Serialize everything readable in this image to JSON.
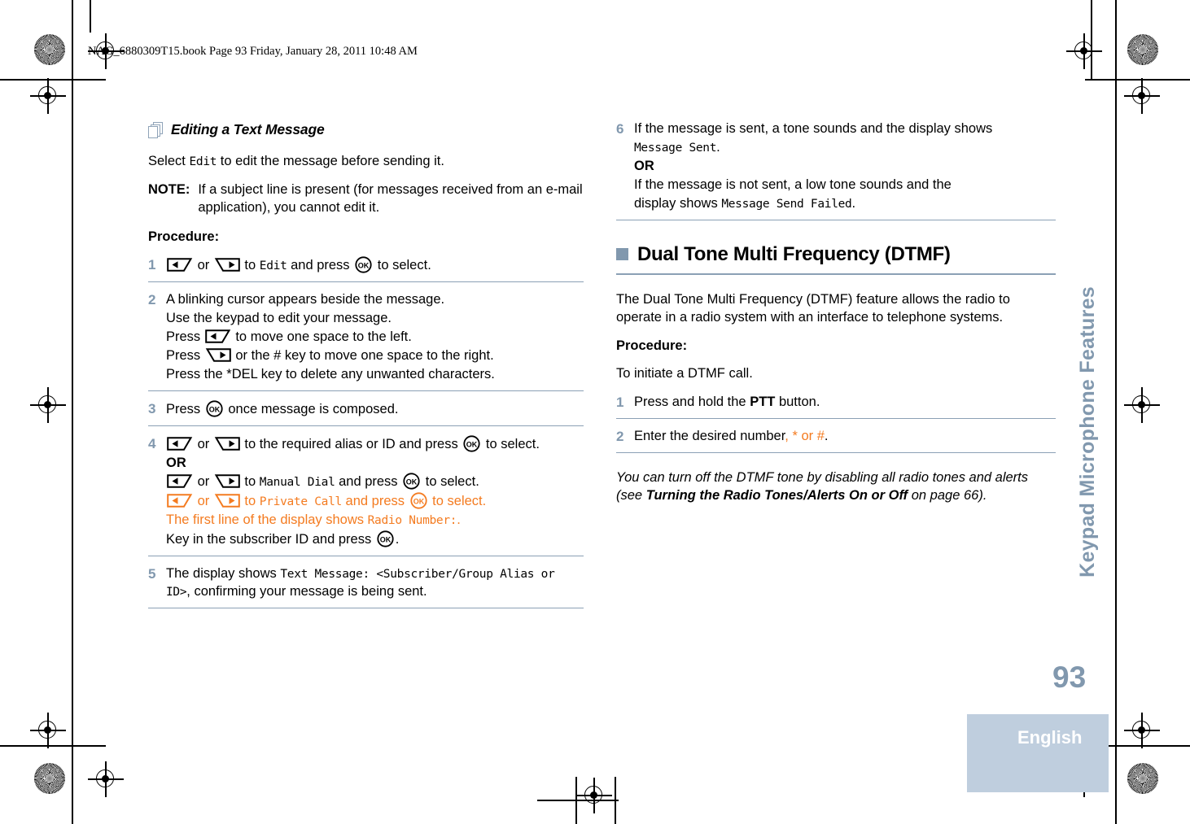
{
  "page": {
    "slug": "NAG_6880309T15.book  Page 93  Friday, January 28, 2011  10:48 AM",
    "number": "93",
    "language": "English",
    "side_tab": "Keypad Microphone Features",
    "accent_blue": "#8198ae",
    "accent_orange": "#F47B20",
    "band_blue": "#bfcede"
  },
  "left_column": {
    "subheading": "Editing a Text Message",
    "intro_prefix": "Select ",
    "intro_mono": "Edit",
    "intro_suffix": " to edit the message before sending it.",
    "note_label": "NOTE:",
    "note_body": "If a subject line is present (for messages received from an e-mail application), you cannot edit it.",
    "procedure_label": "Procedure:",
    "steps": [
      {
        "num": "1",
        "lines": [
          {
            "parts": [
              {
                "type": "key-left"
              },
              {
                "type": "text",
                "text": " or "
              },
              {
                "type": "key-right"
              },
              {
                "type": "text",
                "text": " to "
              },
              {
                "type": "mono",
                "text": "Edit"
              },
              {
                "type": "text",
                "text": " and press "
              },
              {
                "type": "key-ok"
              },
              {
                "type": "text",
                "text": " to select."
              }
            ]
          }
        ]
      },
      {
        "num": "2",
        "lines": [
          {
            "parts": [
              {
                "type": "text",
                "text": "A blinking cursor appears beside the message."
              }
            ]
          },
          {
            "parts": [
              {
                "type": "text",
                "text": "Use the keypad to edit your message."
              }
            ]
          },
          {
            "parts": [
              {
                "type": "text",
                "text": "Press "
              },
              {
                "type": "key-left"
              },
              {
                "type": "text",
                "text": " to move one space to the left."
              }
            ]
          },
          {
            "parts": [
              {
                "type": "text",
                "text": "Press "
              },
              {
                "type": "key-right"
              },
              {
                "type": "text",
                "text": " or the # key to move one space to the right."
              }
            ]
          },
          {
            "parts": [
              {
                "type": "text",
                "text": "Press the *DEL key to delete any unwanted characters."
              }
            ]
          }
        ]
      },
      {
        "num": "3",
        "lines": [
          {
            "parts": [
              {
                "type": "text",
                "text": "Press "
              },
              {
                "type": "key-ok"
              },
              {
                "type": "text",
                "text": " once message is composed."
              }
            ]
          }
        ]
      },
      {
        "num": "4",
        "lines": [
          {
            "parts": [
              {
                "type": "key-left"
              },
              {
                "type": "text",
                "text": " or "
              },
              {
                "type": "key-right"
              },
              {
                "type": "text",
                "text": " to the required alias or ID and press "
              },
              {
                "type": "key-ok"
              },
              {
                "type": "text",
                "text": " to select."
              }
            ]
          },
          {
            "parts": [
              {
                "type": "bold",
                "text": "OR"
              }
            ]
          },
          {
            "parts": [
              {
                "type": "key-left"
              },
              {
                "type": "text",
                "text": " or "
              },
              {
                "type": "key-right"
              },
              {
                "type": "text",
                "text": " to "
              },
              {
                "type": "mono",
                "text": "Manual Dial"
              },
              {
                "type": "text",
                "text": " and press "
              },
              {
                "type": "key-ok"
              },
              {
                "type": "text",
                "text": " to select."
              }
            ]
          },
          {
            "orange": true,
            "parts": [
              {
                "type": "key-left"
              },
              {
                "type": "text",
                "text": " or "
              },
              {
                "type": "key-right"
              },
              {
                "type": "text",
                "text": " to "
              },
              {
                "type": "mono",
                "text": "Private Call"
              },
              {
                "type": "text",
                "text": " and press "
              },
              {
                "type": "key-ok"
              },
              {
                "type": "text",
                "text": " to select."
              }
            ]
          },
          {
            "orange": true,
            "parts": [
              {
                "type": "text",
                "text": "The first line of the display shows "
              },
              {
                "type": "mono",
                "text": "Radio Number:"
              },
              {
                "type": "text",
                "text": "."
              }
            ]
          },
          {
            "parts": [
              {
                "type": "text",
                "text": "Key in the subscriber ID and press "
              },
              {
                "type": "key-ok"
              },
              {
                "type": "text",
                "text": "."
              }
            ]
          }
        ]
      },
      {
        "num": "5",
        "lines": [
          {
            "parts": [
              {
                "type": "text",
                "text": "The display shows "
              },
              {
                "type": "mono",
                "text": "Text Message: <Subscriber/Group Alias or ID>"
              },
              {
                "type": "text",
                "text": ", confirming your message is being sent."
              }
            ]
          }
        ]
      }
    ]
  },
  "right_column": {
    "steps_top": [
      {
        "num": "6",
        "lines": [
          {
            "parts": [
              {
                "type": "text",
                "text": "If the message is sent, a tone sounds and the display shows "
              }
            ]
          },
          {
            "parts": [
              {
                "type": "mono",
                "text": "Message Sent"
              },
              {
                "type": "text",
                "text": "."
              }
            ]
          },
          {
            "parts": [
              {
                "type": "bold",
                "text": "OR"
              }
            ]
          },
          {
            "parts": [
              {
                "type": "text",
                "text": "If the message is not sent, a low tone sounds and the"
              }
            ]
          },
          {
            "parts": [
              {
                "type": "text",
                "text": "display shows "
              },
              {
                "type": "mono",
                "text": "Message Send Failed"
              },
              {
                "type": "text",
                "text": "."
              }
            ]
          }
        ]
      }
    ],
    "section_heading": "Dual Tone Multi Frequency (DTMF)",
    "section_body": "The Dual Tone Multi Frequency (DTMF) feature allows the radio to operate in a radio system with an interface to telephone systems.",
    "procedure_label": "Procedure:",
    "procedure_intro": "To initiate a DTMF call.",
    "steps_bottom": [
      {
        "num": "1",
        "lines": [
          {
            "parts": [
              {
                "type": "text",
                "text": "Press and hold the "
              },
              {
                "type": "bold",
                "text": "PTT"
              },
              {
                "type": "text",
                "text": " button."
              }
            ]
          }
        ]
      },
      {
        "num": "2",
        "lines": [
          {
            "parts": [
              {
                "type": "text",
                "text": "Enter the desired number"
              },
              {
                "type": "orange",
                "text": ", * or #"
              },
              {
                "type": "text",
                "text": "."
              }
            ]
          }
        ]
      }
    ],
    "footnote_parts": [
      {
        "type": "text",
        "text": "You can turn off the DTMF tone by disabling all radio tones and alerts (see "
      },
      {
        "type": "bold",
        "text": "Turning the Radio Tones/Alerts On or Off"
      },
      {
        "type": "text",
        "text": " on page 66)."
      }
    ]
  },
  "icons": {
    "pages_stack": "pages-stack-icon",
    "nav_left": "nav-left-key-icon",
    "nav_right": "nav-right-key-icon",
    "ok": "ok-key-icon",
    "registration": "registration-crosshair-icon",
    "starburst": "starburst-density-icon"
  }
}
